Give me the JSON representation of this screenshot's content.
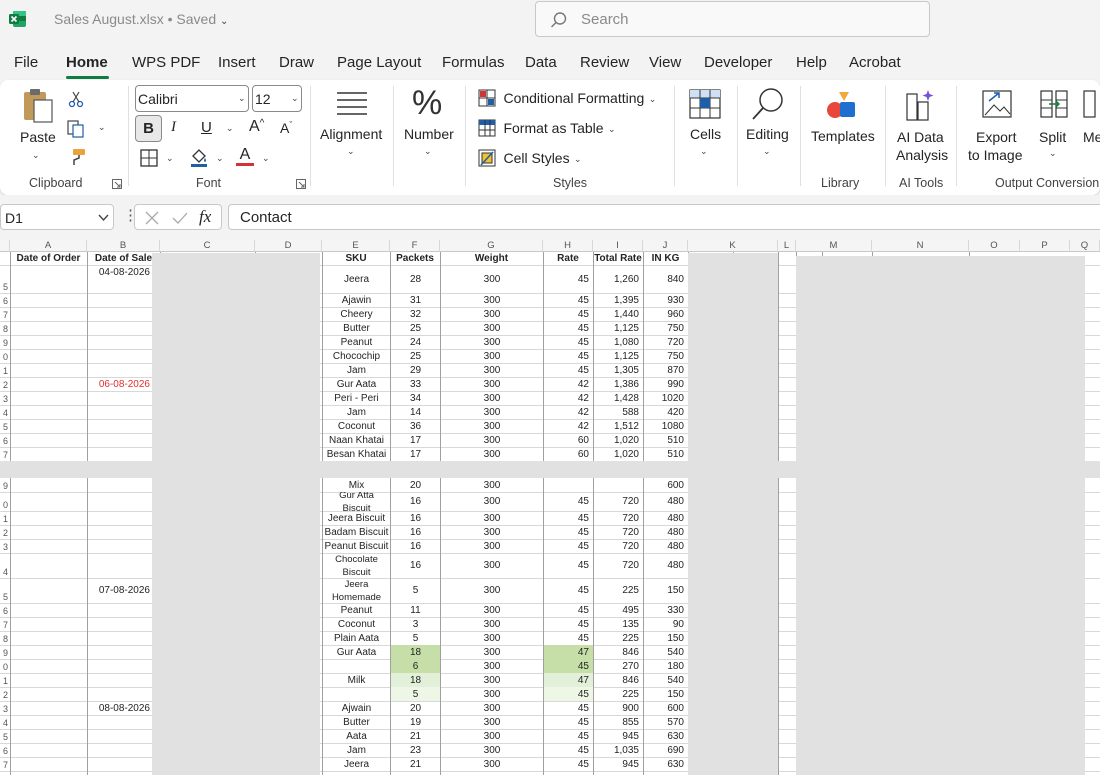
{
  "app": {
    "file_name": "Sales August.xlsx",
    "save_status": "Saved",
    "accent": "#107c41"
  },
  "search": {
    "placeholder": "Search"
  },
  "menu": [
    "File",
    "Home",
    "WPS PDF",
    "Insert",
    "Draw",
    "Page Layout",
    "Formulas",
    "Data",
    "Review",
    "View",
    "Developer",
    "Help",
    "Acrobat"
  ],
  "menu_active": "Home",
  "ribbon": {
    "paste": "Paste",
    "font_name": "Calibri",
    "font_size": "12",
    "bold": "B",
    "italic": "I",
    "underline": "U",
    "grow": "A",
    "shrink": "A",
    "font_color_letter": "A",
    "alignment": "Alignment",
    "number": "Number",
    "cond_format": "Conditional Formatting",
    "format_table": "Format as Table",
    "cell_styles": "Cell Styles",
    "cells": "Cells",
    "editing": "Editing",
    "templates": "Templates",
    "ai_data_l1": "AI Data",
    "ai_data_l2": "Analysis",
    "export_l1": "Export",
    "export_l2": "to Image",
    "split": "Split",
    "more": "Me",
    "groups": {
      "clipboard": "Clipboard",
      "font": "Font",
      "styles": "Styles",
      "library": "Library",
      "ai_tools": "AI Tools",
      "output": "Output Conversion"
    }
  },
  "formula_bar": {
    "name_box": "D1",
    "fx": "fx",
    "value": "Contact"
  },
  "sheet": {
    "columns": [
      "A",
      "B",
      "C",
      "D",
      "E",
      "F",
      "G",
      "H",
      "I",
      "J",
      "K",
      "L",
      "M",
      "N",
      "O",
      "P",
      "Q"
    ],
    "headers": {
      "a": "Date of Order",
      "b": "Date of Sale",
      "e": "SKU",
      "f": "Packets",
      "g": "Weight",
      "h": "Rate",
      "i": "Total Rate",
      "j": "IN KG"
    },
    "row_numbers": [
      "5",
      "6",
      "7",
      "8",
      "9",
      "0",
      "1",
      "2",
      "3",
      "4",
      "5",
      "6",
      "7",
      "9",
      "0",
      "1",
      "2",
      "3",
      "4",
      "5",
      "6",
      "7",
      "8",
      "9",
      "0",
      "1",
      "2",
      "3",
      "4",
      "5",
      "6",
      "7"
    ],
    "dates": [
      {
        "text": "04-08-2026",
        "row": 0,
        "red": false
      },
      {
        "text": "06-08-2026",
        "row": 7,
        "red": true
      },
      {
        "text": "07-08-2026",
        "row": 19,
        "red": false
      },
      {
        "text": "08-08-2026",
        "row": 27,
        "red": false
      }
    ],
    "rows": [
      {
        "sku": "Jeera",
        "packets": "28",
        "weight": "300",
        "rate": "45",
        "total": "1,260",
        "kg": "840"
      },
      {
        "sku": "Ajawin",
        "packets": "31",
        "weight": "300",
        "rate": "45",
        "total": "1,395",
        "kg": "930"
      },
      {
        "sku": "Cheery",
        "packets": "32",
        "weight": "300",
        "rate": "45",
        "total": "1,440",
        "kg": "960"
      },
      {
        "sku": "Butter",
        "packets": "25",
        "weight": "300",
        "rate": "45",
        "total": "1,125",
        "kg": "750"
      },
      {
        "sku": "Peanut",
        "packets": "24",
        "weight": "300",
        "rate": "45",
        "total": "1,080",
        "kg": "720"
      },
      {
        "sku": "Chocochip",
        "packets": "25",
        "weight": "300",
        "rate": "45",
        "total": "1,125",
        "kg": "750"
      },
      {
        "sku": "Jam",
        "packets": "29",
        "weight": "300",
        "rate": "45",
        "total": "1,305",
        "kg": "870"
      },
      {
        "sku": "Gur Aata",
        "packets": "33",
        "weight": "300",
        "rate": "42",
        "total": "1,386",
        "kg": "990"
      },
      {
        "sku": "Peri - Peri",
        "packets": "34",
        "weight": "300",
        "rate": "42",
        "total": "1,428",
        "kg": "1020"
      },
      {
        "sku": "Jam",
        "packets": "14",
        "weight": "300",
        "rate": "42",
        "total": "588",
        "kg": "420"
      },
      {
        "sku": "Coconut",
        "packets": "36",
        "weight": "300",
        "rate": "42",
        "total": "1,512",
        "kg": "1080"
      },
      {
        "sku": "Naan Khatai",
        "packets": "17",
        "weight": "300",
        "rate": "60",
        "total": "1,020",
        "kg": "510"
      },
      {
        "sku": "Besan Khatai",
        "packets": "17",
        "weight": "300",
        "rate": "60",
        "total": "1,020",
        "kg": "510"
      },
      {
        "sku": "Mix",
        "packets": "20",
        "weight": "300",
        "rate": "",
        "total": "",
        "kg": "600"
      },
      {
        "sku": "Gur Atta\nBiscuit",
        "packets": "16",
        "weight": "300",
        "rate": "45",
        "total": "720",
        "kg": "480"
      },
      {
        "sku": "Jeera Biscuit",
        "packets": "16",
        "weight": "300",
        "rate": "45",
        "total": "720",
        "kg": "480"
      },
      {
        "sku": "Badam Biscuit",
        "packets": "16",
        "weight": "300",
        "rate": "45",
        "total": "720",
        "kg": "480"
      },
      {
        "sku": "Peanut Biscuit",
        "packets": "16",
        "weight": "300",
        "rate": "45",
        "total": "720",
        "kg": "480"
      },
      {
        "sku": "Chocolate\nBiscuit",
        "packets": "16",
        "weight": "300",
        "rate": "45",
        "total": "720",
        "kg": "480"
      },
      {
        "sku": "Jeera\nHomemade",
        "packets": "5",
        "weight": "300",
        "rate": "45",
        "total": "225",
        "kg": "150"
      },
      {
        "sku": "Peanut",
        "packets": "11",
        "weight": "300",
        "rate": "45",
        "total": "495",
        "kg": "330"
      },
      {
        "sku": "Coconut",
        "packets": "3",
        "weight": "300",
        "rate": "45",
        "total": "135",
        "kg": "90"
      },
      {
        "sku": "Plain Aata",
        "packets": "5",
        "weight": "300",
        "rate": "45",
        "total": "225",
        "kg": "150"
      },
      {
        "sku": "Gur Aata",
        "packets": "18",
        "weight": "300",
        "rate": "47",
        "total": "846",
        "kg": "540",
        "hl": "dark"
      },
      {
        "sku": "",
        "packets": "6",
        "weight": "300",
        "rate": "45",
        "total": "270",
        "kg": "180",
        "hl": "dark"
      },
      {
        "sku": "Milk",
        "packets": "18",
        "weight": "300",
        "rate": "47",
        "total": "846",
        "kg": "540",
        "hl": "light"
      },
      {
        "sku": "",
        "packets": "5",
        "weight": "300",
        "rate": "45",
        "total": "225",
        "kg": "150",
        "hl": "pale"
      },
      {
        "sku": "Ajwain",
        "packets": "20",
        "weight": "300",
        "rate": "45",
        "total": "900",
        "kg": "600"
      },
      {
        "sku": "Butter",
        "packets": "19",
        "weight": "300",
        "rate": "45",
        "total": "855",
        "kg": "570"
      },
      {
        "sku": "Aata",
        "packets": "21",
        "weight": "300",
        "rate": "45",
        "total": "945",
        "kg": "630"
      },
      {
        "sku": "Jam",
        "packets": "23",
        "weight": "300",
        "rate": "45",
        "total": "1,035",
        "kg": "690"
      },
      {
        "sku": "Jeera",
        "packets": "21",
        "weight": "300",
        "rate": "45",
        "total": "945",
        "kg": "630"
      }
    ],
    "colors": {
      "hl_dark": "#c6dfa8",
      "hl_light": "#e2efd9",
      "hl_pale": "#eef6e6",
      "red_date": "#e03030",
      "redaction": "#e1e1e2"
    }
  }
}
